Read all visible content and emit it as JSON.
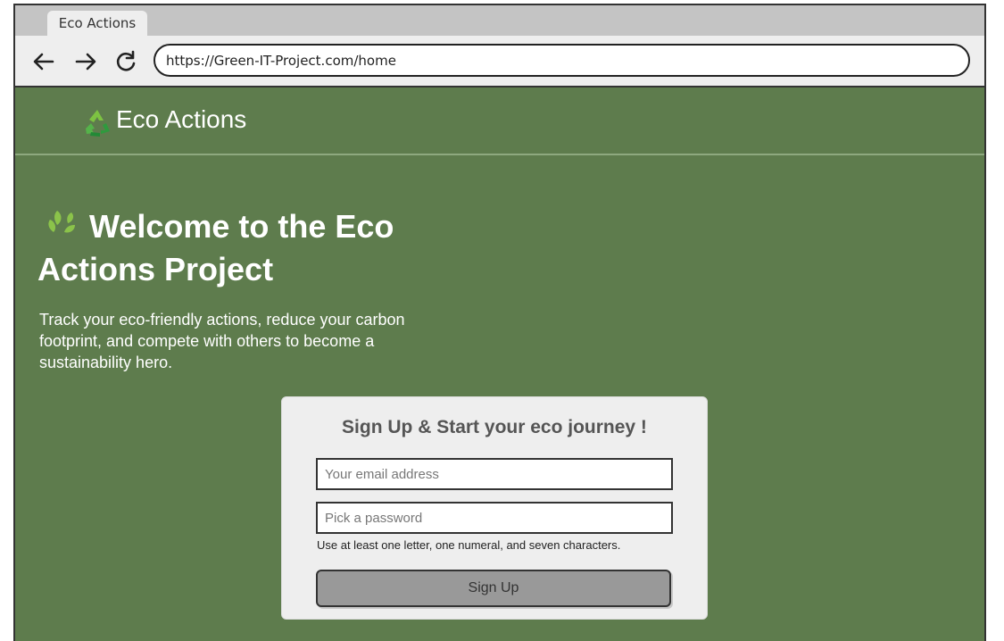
{
  "browser": {
    "tab_title": "Eco Actions",
    "url": "https://Green-IT-Project.com/home"
  },
  "site": {
    "title": "Eco Actions",
    "logo_icon": "recycle-icon"
  },
  "hero": {
    "icon": "leaf-icon",
    "heading": "Welcome to the Eco Actions Project",
    "description": "Track your eco-friendly actions, reduce your carbon footprint, and compete with others to become a sustainability hero."
  },
  "signup": {
    "title": "Sign Up & Start your eco journey !",
    "email_placeholder": "Your email address",
    "email_value": "",
    "password_placeholder": "Pick a password",
    "password_value": "",
    "password_hint": "Use at least one letter, one numeral, and seven characters.",
    "button_label": "Sign Up"
  },
  "colors": {
    "background": "#5e7c4d",
    "card": "#eeeeee",
    "button": "#999999"
  }
}
